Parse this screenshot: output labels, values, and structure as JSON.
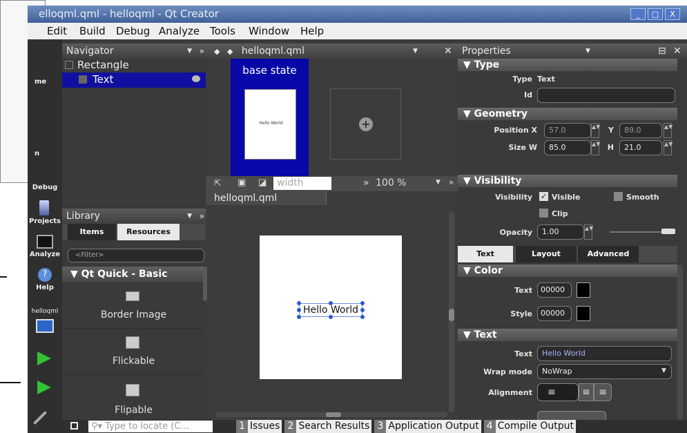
{
  "window": {
    "title": "elloqml.qml - helloqml - Qt Creator",
    "buttons": [
      "_",
      "□",
      "X"
    ]
  },
  "menubar": {
    "items": [
      {
        "label": "Edit",
        "accel": "E"
      },
      {
        "label": "Build",
        "accel": "B"
      },
      {
        "label": "Debug",
        "accel": "D"
      },
      {
        "label": "Analyze",
        "accel": "A"
      },
      {
        "label": "Tools",
        "accel": "T"
      },
      {
        "label": "Window",
        "accel": "W"
      },
      {
        "label": "Help",
        "accel": "H"
      }
    ]
  },
  "modes": {
    "welcome_partial": "me",
    "edit_partial": "n",
    "debug": "Debug",
    "projects": "Projects",
    "analyze": "Analyze",
    "help": "Help",
    "kit": "helloqml"
  },
  "navigator": {
    "title": "Navigator",
    "items": [
      {
        "label": "Rectangle",
        "selected": false
      },
      {
        "label": "Text",
        "selected": true
      }
    ]
  },
  "editor_tab": {
    "label": "helloqml.qml"
  },
  "states": {
    "base_state": "base state",
    "thumb_text": "Hello World"
  },
  "canvas_toolbar": {
    "width_placeholder": "width",
    "zoom": "100 %"
  },
  "canvas": {
    "file_tab": "helloqml.qml",
    "text": "Hello World"
  },
  "library": {
    "title": "Library",
    "tabs": [
      "Items",
      "Resources"
    ],
    "filter_placeholder": "<Filter>",
    "group": "Qt Quick - Basic",
    "items": [
      "Border Image",
      "Flickable",
      "Flipable"
    ]
  },
  "properties": {
    "title": "Properties",
    "type_section": "Type",
    "type_label": "Type",
    "type_value": "Text",
    "id_label": "Id",
    "geometry_section": "Geometry",
    "position_label": "Position",
    "x_label": "X",
    "x_value": "57.0",
    "y_label": "Y",
    "y_value": "89.0",
    "size_label": "Size",
    "w_label": "W",
    "w_value": "85.0",
    "h_label": "H",
    "h_value": "21.0",
    "visibility_section": "Visibility",
    "visibility_label": "Visibility",
    "visible_label": "Visible",
    "smooth_label": "Smooth",
    "clip_label": "Clip",
    "opacity_label": "Opacity",
    "opacity_value": "1.00",
    "opacity_fraction": 1.0,
    "tabs": [
      "Text",
      "Layout",
      "Advanced"
    ],
    "color_section": "Color",
    "color_text_label": "Text",
    "color_text_value": "00000",
    "color_style_label": "Style",
    "color_style_value": "00000",
    "text_section": "Text",
    "text_label": "Text",
    "text_value": "Hello World",
    "wrap_label": "Wrap mode",
    "wrap_value": "NoWrap",
    "alignment_label": "Alignment"
  },
  "statusbar": {
    "locator_placeholder": "Type to locate (C…",
    "panes": [
      {
        "num": "1",
        "label": "Issues"
      },
      {
        "num": "2",
        "label": "Search Results"
      },
      {
        "num": "3",
        "label": "Application Output"
      },
      {
        "num": "4",
        "label": "Compile Output"
      }
    ]
  },
  "colors": {
    "selection_blue": "#1010a0",
    "panel_dark": "#3a3a3a",
    "title_blue": "#4f6fa8"
  }
}
